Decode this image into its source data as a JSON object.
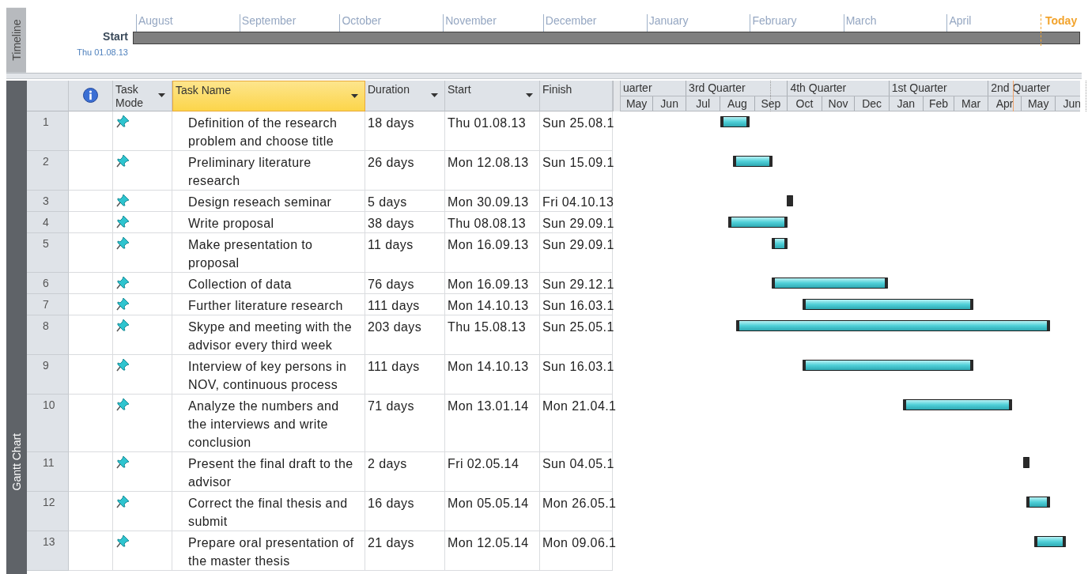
{
  "timeline": {
    "label": "Timeline",
    "start_label": "Start",
    "start_date": "Thu 01.08.13",
    "today_label": "Today",
    "months": [
      "August",
      "September",
      "October",
      "November",
      "December",
      "January",
      "February",
      "March",
      "April"
    ]
  },
  "gantt": {
    "label": "Gantt Chart",
    "columns": [
      {
        "kind": "info",
        "selected": false,
        "dropdown": false
      },
      {
        "kind": "text",
        "label": "Task Mode",
        "selected": false,
        "dropdown": true
      },
      {
        "kind": "text",
        "label": "Task Name",
        "selected": true,
        "dropdown": true
      },
      {
        "kind": "text",
        "label": "Duration",
        "selected": false,
        "dropdown": true
      },
      {
        "kind": "text",
        "label": "Start",
        "selected": false,
        "dropdown": true
      },
      {
        "kind": "text",
        "label": "Finish",
        "selected": false,
        "dropdown": false
      }
    ],
    "quarters": [
      "uarter",
      "3rd Quarter",
      "4th Quarter",
      "1st Quarter",
      "2nd Quarter"
    ],
    "months": [
      "May",
      "Jun",
      "Jul",
      "Aug",
      "Sep",
      "Oct",
      "Nov",
      "Dec",
      "Jan",
      "Feb",
      "Mar",
      "Apr",
      "May",
      "Jun"
    ],
    "rows": [
      {
        "id": "1",
        "name": "Definition of the research problem and choose title",
        "duration": "18 days",
        "start": "Thu 01.08.13",
        "finish": "Sun 25.08.1"
      },
      {
        "id": "2",
        "name": "Preliminary literature research",
        "duration": "26 days",
        "start": "Mon 12.08.13",
        "finish": "Sun 15.09.1"
      },
      {
        "id": "3",
        "name": "Design reseach seminar",
        "duration": "5 days",
        "start": "Mon 30.09.13",
        "finish": "Fri 04.10.13"
      },
      {
        "id": "4",
        "name": "Write proposal",
        "duration": "38 days",
        "start": "Thu 08.08.13",
        "finish": "Sun 29.09.1"
      },
      {
        "id": "5",
        "name": "Make presentation to proposal",
        "duration": "11 days",
        "start": "Mon 16.09.13",
        "finish": "Sun 29.09.1"
      },
      {
        "id": "6",
        "name": "Collection of data",
        "duration": "76 days",
        "start": "Mon 16.09.13",
        "finish": "Sun 29.12.1"
      },
      {
        "id": "7",
        "name": "Further literature research",
        "duration": "111 days",
        "start": "Mon 14.10.13",
        "finish": "Sun 16.03.1"
      },
      {
        "id": "8",
        "name": "Skype and meeting with the advisor every third week",
        "duration": "203 days",
        "start": "Thu 15.08.13",
        "finish": "Sun 25.05.1"
      },
      {
        "id": "9",
        "name": "Interview of key persons in NOV, continuous process",
        "duration": "111 days",
        "start": "Mon 14.10.13",
        "finish": "Sun 16.03.1"
      },
      {
        "id": "10",
        "name": "Analyze the numbers and the interviews and write conclusion",
        "duration": "71 days",
        "start": "Mon 13.01.14",
        "finish": "Mon 21.04.1"
      },
      {
        "id": "11",
        "name": "Present the final draft to the advisor",
        "duration": "2 days",
        "start": "Fri 02.05.14",
        "finish": "Sun 04.05.1"
      },
      {
        "id": "12",
        "name": "Correct the final thesis and submit",
        "duration": "16 days",
        "start": "Mon 05.05.14",
        "finish": "Mon 26.05.1"
      },
      {
        "id": "13",
        "name": "Prepare oral presentation of the master thesis",
        "duration": "21 days",
        "start": "Mon 12.05.14",
        "finish": "Mon 09.06.1"
      }
    ]
  }
}
